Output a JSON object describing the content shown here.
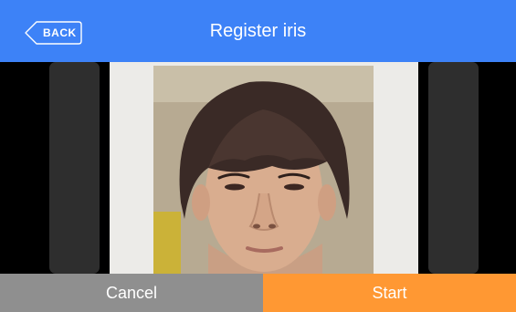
{
  "header": {
    "back_label": "BACK",
    "title": "Register iris",
    "back_icon": "chevron-left-icon"
  },
  "camera": {
    "subject": "face-preview"
  },
  "footer": {
    "cancel_label": "Cancel",
    "start_label": "Start"
  },
  "colors": {
    "header": "#3d82f7",
    "cancel": "#8f8f8f",
    "start": "#ff9833"
  }
}
